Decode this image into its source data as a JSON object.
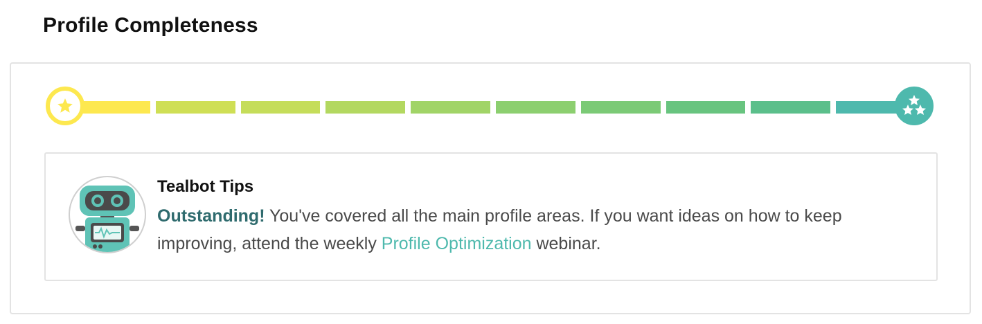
{
  "page": {
    "title": "Profile Completeness"
  },
  "progress": {
    "completion_fraction": 1.0,
    "segment_colors": [
      "#fde84f",
      "#cfdf55",
      "#c5dd5a",
      "#b3d860",
      "#a1d467",
      "#8ccf6f",
      "#7bca76",
      "#68c47f",
      "#5bbf8b",
      "#4eb9ad"
    ],
    "start_icon": "star-icon",
    "finish_icon": "three-stars-icon",
    "start_color": "#fde84f",
    "finish_color": "#4eb9ad"
  },
  "tips": {
    "title": "Tealbot Tips",
    "avatar_icon": "tealbot-robot-icon",
    "highlight": "Outstanding!",
    "body_before_link": " You've covered all the main profile areas. If you want ideas on how to keep improving, attend the weekly ",
    "link_label": "Profile Optimization",
    "body_after_link": " webinar."
  },
  "colors": {
    "highlight": "#2f6b6e",
    "link": "#4eb9ad",
    "border": "#e3e3e3"
  }
}
